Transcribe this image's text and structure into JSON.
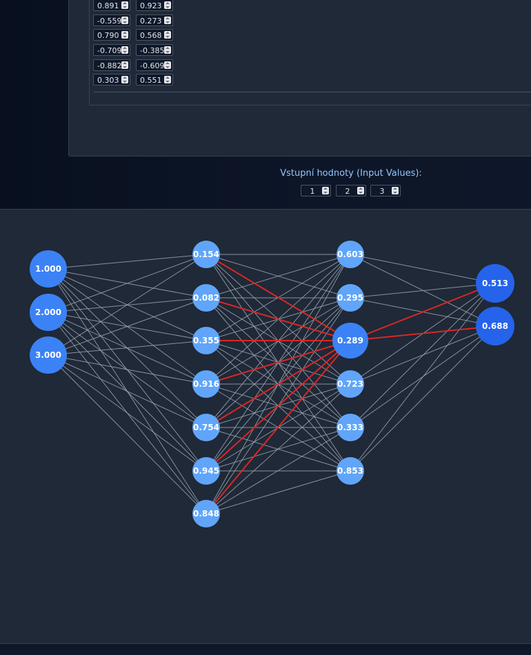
{
  "weights": {
    "rows": [
      [
        "0.891",
        "0.923"
      ],
      [
        "-0.559",
        "0.273"
      ],
      [
        "0.790",
        "0.568"
      ],
      [
        "-0.709",
        "-0.385"
      ],
      [
        "-0.882",
        "-0.609"
      ],
      [
        "0.303",
        "0.551"
      ]
    ]
  },
  "inputs": {
    "label": "Vstupní hodnoty (Input Values):",
    "values": [
      "1",
      "2",
      "3"
    ]
  },
  "network": {
    "layers": [
      [
        "1.000",
        "2.000",
        "3.000"
      ],
      [
        "0.154",
        "0.082",
        "0.355",
        "0.916",
        "0.754",
        "0.945",
        "0.848"
      ],
      [
        "0.603",
        "0.295",
        "0.289",
        "0.723",
        "0.333",
        "0.853"
      ],
      [
        "0.513",
        "0.688"
      ]
    ],
    "highlighted_node": {
      "layer": 2,
      "index": 2
    },
    "colors": {
      "input_node": "#3b82f6",
      "hidden_node": "#60a5fa",
      "highlight_node": "#3b82f6",
      "output_node": "#2563eb",
      "edge": "#9ca3af",
      "highlight_edge": "#dc2626"
    }
  }
}
